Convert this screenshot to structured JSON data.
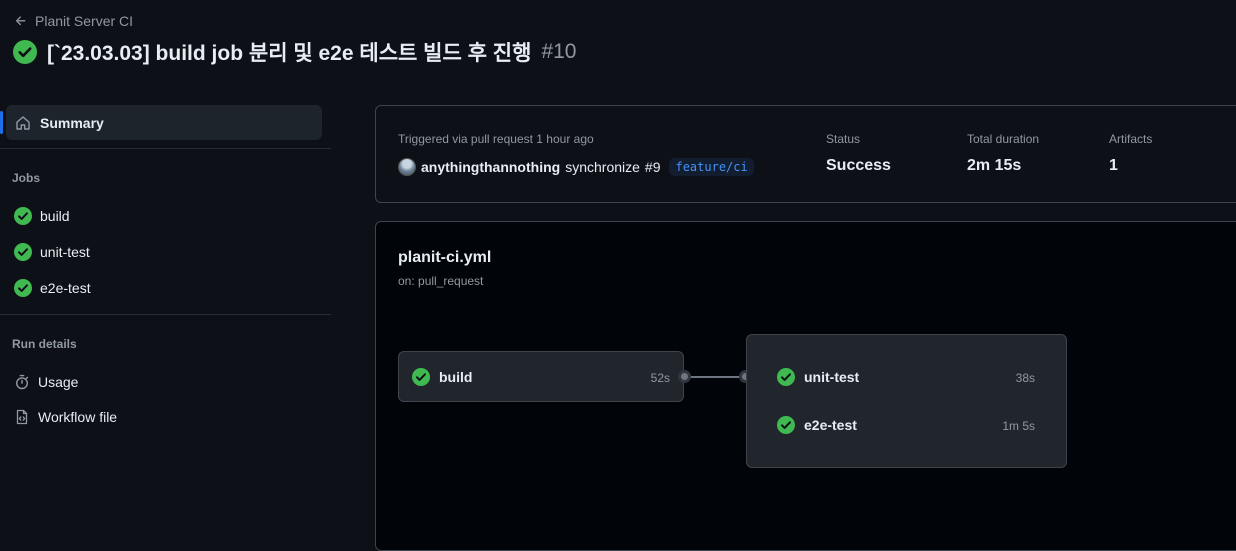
{
  "header": {
    "back_label": "Planit Server CI",
    "title": "[`23.03.03] build job 분리 및 e2e 테스트 빌드 후 진행",
    "run_number": "#10"
  },
  "sidebar": {
    "summary_label": "Summary",
    "jobs_heading": "Jobs",
    "jobs": [
      {
        "label": "build"
      },
      {
        "label": "unit-test"
      },
      {
        "label": "e2e-test"
      }
    ],
    "run_details_heading": "Run details",
    "run_details": [
      {
        "label": "Usage",
        "icon": "stopwatch-icon"
      },
      {
        "label": "Workflow file",
        "icon": "file-code-icon"
      }
    ]
  },
  "summary": {
    "trigger_text": "Triggered via pull request 1 hour ago",
    "actor": "anythingthannothing",
    "action": "synchronize",
    "pr_ref": "#9",
    "branch": "feature/ci",
    "status_label": "Status",
    "status_value": "Success",
    "duration_label": "Total duration",
    "duration_value": "2m 15s",
    "artifacts_label": "Artifacts",
    "artifacts_value": "1"
  },
  "workflow": {
    "file_name": "planit-ci.yml",
    "trigger": "on: pull_request",
    "jobs": [
      {
        "name": "build",
        "time": "52s"
      },
      {
        "name": "unit-test",
        "time": "38s"
      },
      {
        "name": "e2e-test",
        "time": "1m 5s"
      }
    ]
  },
  "colors": {
    "success": "#3fb950",
    "accent": "#1f6feb",
    "background": "#0d1117"
  }
}
